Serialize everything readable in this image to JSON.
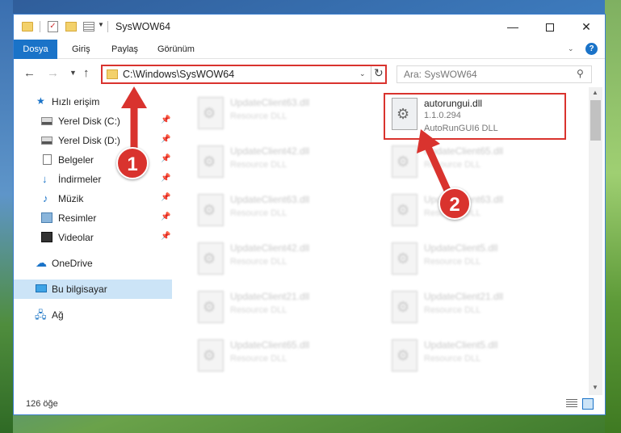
{
  "window": {
    "title": "SysWOW64",
    "help_icon": "?",
    "controls": {
      "minimize": "—",
      "maximize": "",
      "close": "✕"
    }
  },
  "ribbon": {
    "tabs": [
      "Dosya",
      "Giriş",
      "Paylaş",
      "Görünüm"
    ]
  },
  "address": {
    "path": "C:\\Windows\\SysWOW64",
    "search_placeholder": "Ara: SysWOW64"
  },
  "sidebar": {
    "items": [
      {
        "label": "Hızlı erişim",
        "icon": "star-icon",
        "pinned": false
      },
      {
        "label": "Yerel Disk (C:)",
        "icon": "drive-icon",
        "pinned": true
      },
      {
        "label": "Yerel Disk (D:)",
        "icon": "drive-icon",
        "pinned": true
      },
      {
        "label": "Belgeler",
        "icon": "documents-icon",
        "pinned": true
      },
      {
        "label": "İndirmeler",
        "icon": "downloads-icon",
        "pinned": true
      },
      {
        "label": "Müzik",
        "icon": "music-icon",
        "pinned": true
      },
      {
        "label": "Resimler",
        "icon": "pictures-icon",
        "pinned": true
      },
      {
        "label": "Videolar",
        "icon": "videos-icon",
        "pinned": true
      },
      {
        "label": "OneDrive",
        "icon": "cloud-icon",
        "pinned": false
      },
      {
        "label": "Bu bilgisayar",
        "icon": "computer-icon",
        "pinned": false,
        "selected": true
      },
      {
        "label": "Ağ",
        "icon": "network-icon",
        "pinned": false
      }
    ]
  },
  "files": {
    "left_column": [
      {
        "name": "UpdateClient63.dll",
        "type": "Resource DLL"
      },
      {
        "name": "UpdateClient42.dll",
        "type": "Resource DLL"
      },
      {
        "name": "UpdateClient63.dll",
        "type": "Resource DLL"
      },
      {
        "name": "UpdateClient42.dll",
        "type": "Resource DLL"
      },
      {
        "name": "UpdateClient21.dll",
        "type": "Resource DLL"
      },
      {
        "name": "UpdateClient65.dll",
        "type": "Resource DLL"
      }
    ],
    "right_column": [
      {
        "name": "autorungui.dll",
        "version": "1.1.0.294",
        "description": "AutoRunGUI6 DLL",
        "highlighted": true
      },
      {
        "name": "UpdateClient65.dll",
        "type": "Resource DLL"
      },
      {
        "name": "UpdateClient63.dll",
        "type": "Resource DLL"
      },
      {
        "name": "UpdateClient5.dll",
        "type": "Resource DLL"
      },
      {
        "name": "UpdateClient21.dll",
        "type": "Resource DLL"
      },
      {
        "name": "UpdateClient5.dll",
        "type": "Resource DLL"
      }
    ]
  },
  "status": {
    "item_count": "126 öğe"
  },
  "annotations": {
    "callout_1": "1",
    "callout_2": "2",
    "color": "#d9332e"
  }
}
